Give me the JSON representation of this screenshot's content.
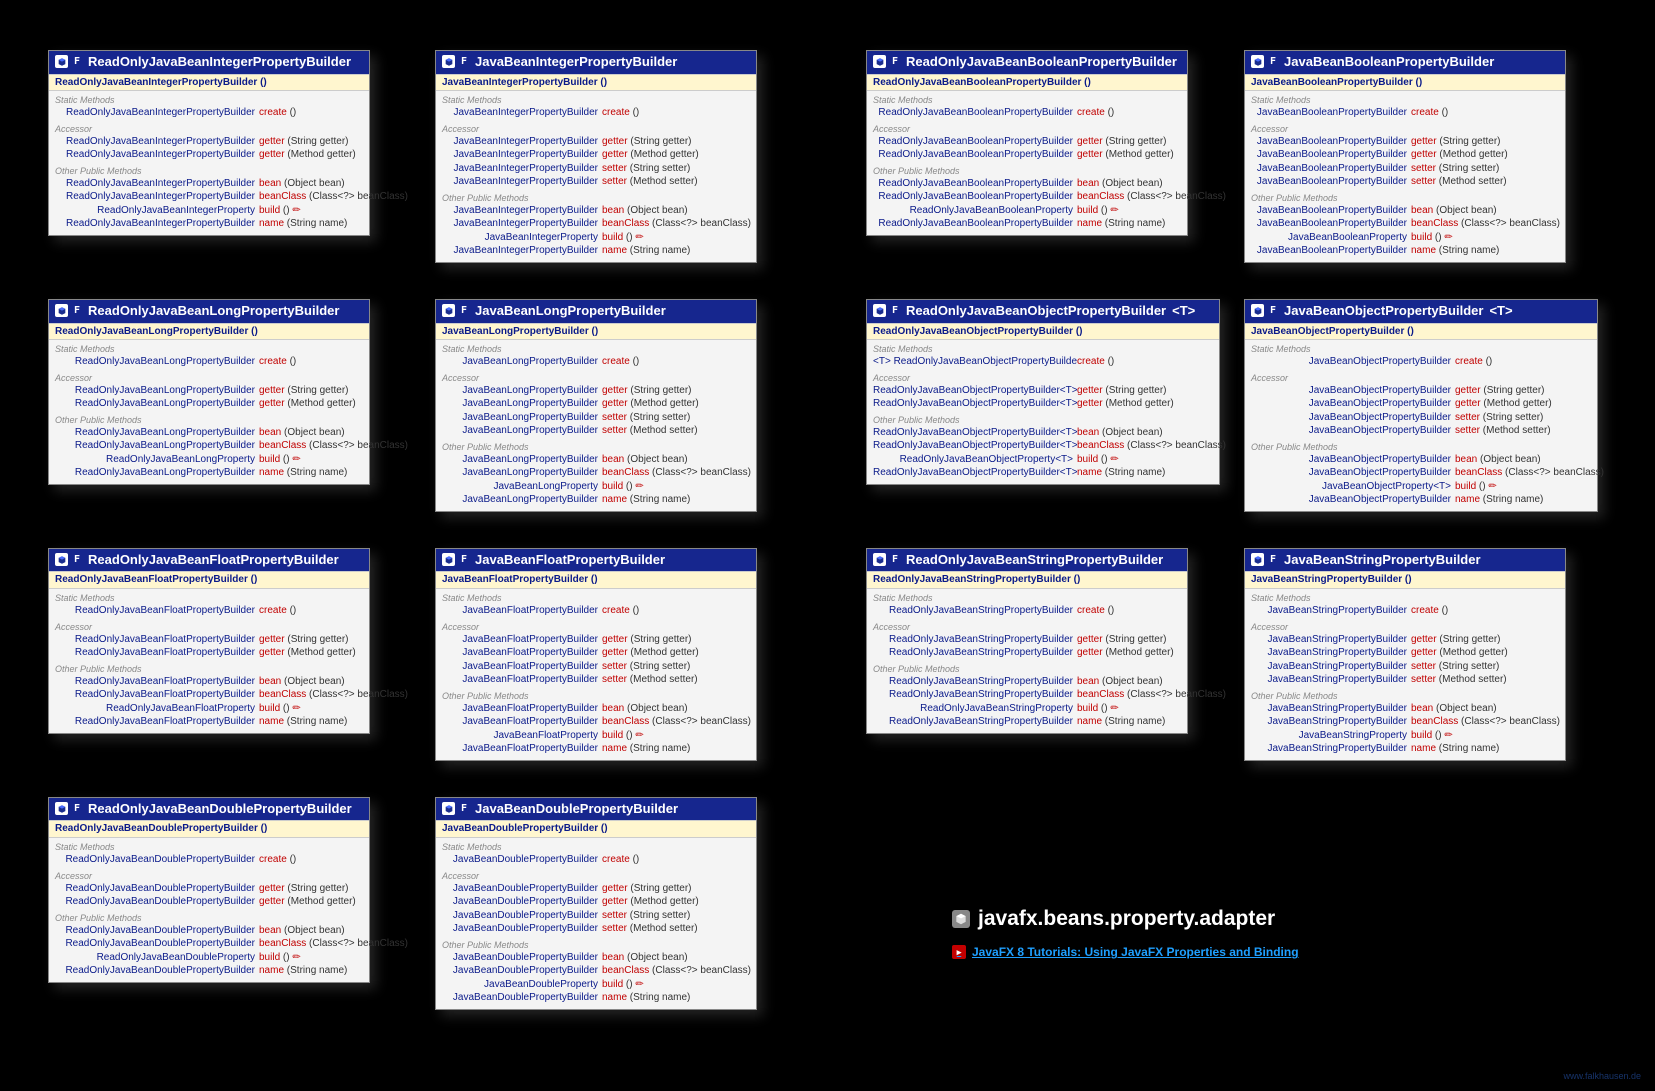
{
  "package_title": "javafx.beans.property.adapter",
  "tutorial_link": "JavaFX 8 Tutorials: Using JavaFX Properties and Binding",
  "watermark": "www.falkhausen.de",
  "final_prefix": "F",
  "sections": {
    "static": "Static Methods",
    "accessor": "Accessor",
    "other": "Other Public Methods"
  },
  "classes": [
    {
      "id": "ro-integer",
      "is_final": true,
      "title": "ReadOnlyJavaBeanIntegerPropertyBuilder",
      "constructor": "ReadOnlyJavaBeanIntegerPropertyBuilder ()",
      "static": [
        {
          "ret": "ReadOnlyJavaBeanIntegerPropertyBuilder",
          "name": "create",
          "params": "()"
        }
      ],
      "accessor": [
        {
          "ret": "ReadOnlyJavaBeanIntegerPropertyBuilder",
          "name": "getter",
          "params": "(String getter)"
        },
        {
          "ret": "ReadOnlyJavaBeanIntegerPropertyBuilder",
          "name": "getter",
          "params": "(Method getter)"
        }
      ],
      "other": [
        {
          "ret": "ReadOnlyJavaBeanIntegerPropertyBuilder",
          "name": "bean",
          "params": "(Object bean)"
        },
        {
          "ret": "ReadOnlyJavaBeanIntegerPropertyBuilder",
          "name": "beanClass",
          "params": "(Class<?> beanClass)"
        },
        {
          "ret": "ReadOnlyJavaBeanIntegerProperty",
          "name": "build",
          "params": "()",
          "throws": true
        },
        {
          "ret": "ReadOnlyJavaBeanIntegerPropertyBuilder",
          "name": "name",
          "params": "(String name)"
        }
      ]
    },
    {
      "id": "rw-integer",
      "is_final": true,
      "title": "JavaBeanIntegerPropertyBuilder",
      "constructor": "JavaBeanIntegerPropertyBuilder ()",
      "static": [
        {
          "ret": "JavaBeanIntegerPropertyBuilder",
          "name": "create",
          "params": "()"
        }
      ],
      "accessor": [
        {
          "ret": "JavaBeanIntegerPropertyBuilder",
          "name": "getter",
          "params": "(String getter)"
        },
        {
          "ret": "JavaBeanIntegerPropertyBuilder",
          "name": "getter",
          "params": "(Method getter)"
        },
        {
          "ret": "JavaBeanIntegerPropertyBuilder",
          "name": "setter",
          "params": "(String setter)"
        },
        {
          "ret": "JavaBeanIntegerPropertyBuilder",
          "name": "setter",
          "params": "(Method setter)"
        }
      ],
      "other": [
        {
          "ret": "JavaBeanIntegerPropertyBuilder",
          "name": "bean",
          "params": "(Object bean)"
        },
        {
          "ret": "JavaBeanIntegerPropertyBuilder",
          "name": "beanClass",
          "params": "(Class<?> beanClass)"
        },
        {
          "ret": "JavaBeanIntegerProperty",
          "name": "build",
          "params": "()",
          "throws": true
        },
        {
          "ret": "JavaBeanIntegerPropertyBuilder",
          "name": "name",
          "params": "(String name)"
        }
      ]
    },
    {
      "id": "ro-boolean",
      "is_final": true,
      "title": "ReadOnlyJavaBeanBooleanPropertyBuilder",
      "constructor": "ReadOnlyJavaBeanBooleanPropertyBuilder ()",
      "static": [
        {
          "ret": "ReadOnlyJavaBeanBooleanPropertyBuilder",
          "name": "create",
          "params": "()"
        }
      ],
      "accessor": [
        {
          "ret": "ReadOnlyJavaBeanBooleanPropertyBuilder",
          "name": "getter",
          "params": "(String getter)"
        },
        {
          "ret": "ReadOnlyJavaBeanBooleanPropertyBuilder",
          "name": "getter",
          "params": "(Method getter)"
        }
      ],
      "other": [
        {
          "ret": "ReadOnlyJavaBeanBooleanPropertyBuilder",
          "name": "bean",
          "params": "(Object bean)"
        },
        {
          "ret": "ReadOnlyJavaBeanBooleanPropertyBuilder",
          "name": "beanClass",
          "params": "(Class<?> beanClass)"
        },
        {
          "ret": "ReadOnlyJavaBeanBooleanProperty",
          "name": "build",
          "params": "()",
          "throws": true
        },
        {
          "ret": "ReadOnlyJavaBeanBooleanPropertyBuilder",
          "name": "name",
          "params": "(String name)"
        }
      ]
    },
    {
      "id": "rw-boolean",
      "is_final": true,
      "title": "JavaBeanBooleanPropertyBuilder",
      "constructor": "JavaBeanBooleanPropertyBuilder ()",
      "static": [
        {
          "ret": "JavaBeanBooleanPropertyBuilder",
          "name": "create",
          "params": "()"
        }
      ],
      "accessor": [
        {
          "ret": "JavaBeanBooleanPropertyBuilder",
          "name": "getter",
          "params": "(String getter)"
        },
        {
          "ret": "JavaBeanBooleanPropertyBuilder",
          "name": "getter",
          "params": "(Method getter)"
        },
        {
          "ret": "JavaBeanBooleanPropertyBuilder",
          "name": "setter",
          "params": "(String setter)"
        },
        {
          "ret": "JavaBeanBooleanPropertyBuilder",
          "name": "setter",
          "params": "(Method setter)"
        }
      ],
      "other": [
        {
          "ret": "JavaBeanBooleanPropertyBuilder",
          "name": "bean",
          "params": "(Object bean)"
        },
        {
          "ret": "JavaBeanBooleanPropertyBuilder",
          "name": "beanClass",
          "params": "(Class<?> beanClass)"
        },
        {
          "ret": "JavaBeanBooleanProperty",
          "name": "build",
          "params": "()",
          "throws": true
        },
        {
          "ret": "JavaBeanBooleanPropertyBuilder",
          "name": "name",
          "params": "(String name)"
        }
      ]
    },
    {
      "id": "ro-long",
      "is_final": true,
      "title": "ReadOnlyJavaBeanLongPropertyBuilder",
      "constructor": "ReadOnlyJavaBeanLongPropertyBuilder ()",
      "static": [
        {
          "ret": "ReadOnlyJavaBeanLongPropertyBuilder",
          "name": "create",
          "params": "()"
        }
      ],
      "accessor": [
        {
          "ret": "ReadOnlyJavaBeanLongPropertyBuilder",
          "name": "getter",
          "params": "(String getter)"
        },
        {
          "ret": "ReadOnlyJavaBeanLongPropertyBuilder",
          "name": "getter",
          "params": "(Method getter)"
        }
      ],
      "other": [
        {
          "ret": "ReadOnlyJavaBeanLongPropertyBuilder",
          "name": "bean",
          "params": "(Object bean)"
        },
        {
          "ret": "ReadOnlyJavaBeanLongPropertyBuilder",
          "name": "beanClass",
          "params": "(Class<?> beanClass)"
        },
        {
          "ret": "ReadOnlyJavaBeanLongProperty",
          "name": "build",
          "params": "()",
          "throws": true
        },
        {
          "ret": "ReadOnlyJavaBeanLongPropertyBuilder",
          "name": "name",
          "params": "(String name)"
        }
      ]
    },
    {
      "id": "rw-long",
      "is_final": true,
      "title": "JavaBeanLongPropertyBuilder",
      "constructor": "JavaBeanLongPropertyBuilder ()",
      "static": [
        {
          "ret": "JavaBeanLongPropertyBuilder",
          "name": "create",
          "params": "()"
        }
      ],
      "accessor": [
        {
          "ret": "JavaBeanLongPropertyBuilder",
          "name": "getter",
          "params": "(String getter)"
        },
        {
          "ret": "JavaBeanLongPropertyBuilder",
          "name": "getter",
          "params": "(Method getter)"
        },
        {
          "ret": "JavaBeanLongPropertyBuilder",
          "name": "setter",
          "params": "(String setter)"
        },
        {
          "ret": "JavaBeanLongPropertyBuilder",
          "name": "setter",
          "params": "(Method setter)"
        }
      ],
      "other": [
        {
          "ret": "JavaBeanLongPropertyBuilder",
          "name": "bean",
          "params": "(Object bean)"
        },
        {
          "ret": "JavaBeanLongPropertyBuilder",
          "name": "beanClass",
          "params": "(Class<?> beanClass)"
        },
        {
          "ret": "JavaBeanLongProperty",
          "name": "build",
          "params": "()",
          "throws": true
        },
        {
          "ret": "JavaBeanLongPropertyBuilder",
          "name": "name",
          "params": "(String name)"
        }
      ]
    },
    {
      "id": "ro-object",
      "is_final": true,
      "title": "ReadOnlyJavaBeanObjectPropertyBuilder",
      "generic": "<T>",
      "constructor": "ReadOnlyJavaBeanObjectPropertyBuilder ()",
      "static": [
        {
          "ret": "<T> ReadOnlyJavaBeanObjectPropertyBuilder<T>",
          "name": "create",
          "params": "()"
        }
      ],
      "accessor": [
        {
          "ret": "ReadOnlyJavaBeanObjectPropertyBuilder<T>",
          "name": "getter",
          "params": "(String getter)"
        },
        {
          "ret": "ReadOnlyJavaBeanObjectPropertyBuilder<T>",
          "name": "getter",
          "params": "(Method getter)"
        }
      ],
      "other": [
        {
          "ret": "ReadOnlyJavaBeanObjectPropertyBuilder<T>",
          "name": "bean",
          "params": "(Object bean)"
        },
        {
          "ret": "ReadOnlyJavaBeanObjectPropertyBuilder<T>",
          "name": "beanClass",
          "params": "(Class<?> beanClass)"
        },
        {
          "ret": "ReadOnlyJavaBeanObjectProperty<T>",
          "name": "build",
          "params": "()",
          "throws": true
        },
        {
          "ret": "ReadOnlyJavaBeanObjectPropertyBuilder<T>",
          "name": "name",
          "params": "(String name)"
        }
      ]
    },
    {
      "id": "rw-object",
      "is_final": true,
      "title": "JavaBeanObjectPropertyBuilder",
      "generic": "<T>",
      "constructor": "JavaBeanObjectPropertyBuilder ()",
      "static": [
        {
          "ret": "JavaBeanObjectPropertyBuilder",
          "name": "create",
          "params": "()"
        }
      ],
      "accessor": [
        {
          "ret": "JavaBeanObjectPropertyBuilder",
          "name": "getter",
          "params": "(String getter)"
        },
        {
          "ret": "JavaBeanObjectPropertyBuilder",
          "name": "getter",
          "params": "(Method getter)"
        },
        {
          "ret": "JavaBeanObjectPropertyBuilder",
          "name": "setter",
          "params": "(String setter)"
        },
        {
          "ret": "JavaBeanObjectPropertyBuilder",
          "name": "setter",
          "params": "(Method setter)"
        }
      ],
      "other": [
        {
          "ret": "JavaBeanObjectPropertyBuilder",
          "name": "bean",
          "params": "(Object bean)"
        },
        {
          "ret": "JavaBeanObjectPropertyBuilder",
          "name": "beanClass",
          "params": "(Class<?> beanClass)"
        },
        {
          "ret": "JavaBeanObjectProperty<T>",
          "name": "build",
          "params": "()",
          "throws": true
        },
        {
          "ret": "JavaBeanObjectPropertyBuilder",
          "name": "name",
          "params": "(String name)"
        }
      ]
    },
    {
      "id": "ro-float",
      "is_final": true,
      "title": "ReadOnlyJavaBeanFloatPropertyBuilder",
      "constructor": "ReadOnlyJavaBeanFloatPropertyBuilder ()",
      "static": [
        {
          "ret": "ReadOnlyJavaBeanFloatPropertyBuilder",
          "name": "create",
          "params": "()"
        }
      ],
      "accessor": [
        {
          "ret": "ReadOnlyJavaBeanFloatPropertyBuilder",
          "name": "getter",
          "params": "(String getter)"
        },
        {
          "ret": "ReadOnlyJavaBeanFloatPropertyBuilder",
          "name": "getter",
          "params": "(Method getter)"
        }
      ],
      "other": [
        {
          "ret": "ReadOnlyJavaBeanFloatPropertyBuilder",
          "name": "bean",
          "params": "(Object bean)"
        },
        {
          "ret": "ReadOnlyJavaBeanFloatPropertyBuilder",
          "name": "beanClass",
          "params": "(Class<?> beanClass)"
        },
        {
          "ret": "ReadOnlyJavaBeanFloatProperty",
          "name": "build",
          "params": "()",
          "throws": true
        },
        {
          "ret": "ReadOnlyJavaBeanFloatPropertyBuilder",
          "name": "name",
          "params": "(String name)"
        }
      ]
    },
    {
      "id": "rw-float",
      "is_final": true,
      "title": "JavaBeanFloatPropertyBuilder",
      "constructor": "JavaBeanFloatPropertyBuilder ()",
      "static": [
        {
          "ret": "JavaBeanFloatPropertyBuilder",
          "name": "create",
          "params": "()"
        }
      ],
      "accessor": [
        {
          "ret": "JavaBeanFloatPropertyBuilder",
          "name": "getter",
          "params": "(String getter)"
        },
        {
          "ret": "JavaBeanFloatPropertyBuilder",
          "name": "getter",
          "params": "(Method getter)"
        },
        {
          "ret": "JavaBeanFloatPropertyBuilder",
          "name": "setter",
          "params": "(String setter)"
        },
        {
          "ret": "JavaBeanFloatPropertyBuilder",
          "name": "setter",
          "params": "(Method setter)"
        }
      ],
      "other": [
        {
          "ret": "JavaBeanFloatPropertyBuilder",
          "name": "bean",
          "params": "(Object bean)"
        },
        {
          "ret": "JavaBeanFloatPropertyBuilder",
          "name": "beanClass",
          "params": "(Class<?> beanClass)"
        },
        {
          "ret": "JavaBeanFloatProperty",
          "name": "build",
          "params": "()",
          "throws": true
        },
        {
          "ret": "JavaBeanFloatPropertyBuilder",
          "name": "name",
          "params": "(String name)"
        }
      ]
    },
    {
      "id": "ro-string",
      "is_final": true,
      "title": "ReadOnlyJavaBeanStringPropertyBuilder",
      "constructor": "ReadOnlyJavaBeanStringPropertyBuilder ()",
      "static": [
        {
          "ret": "ReadOnlyJavaBeanStringPropertyBuilder",
          "name": "create",
          "params": "()"
        }
      ],
      "accessor": [
        {
          "ret": "ReadOnlyJavaBeanStringPropertyBuilder",
          "name": "getter",
          "params": "(String getter)"
        },
        {
          "ret": "ReadOnlyJavaBeanStringPropertyBuilder",
          "name": "getter",
          "params": "(Method getter)"
        }
      ],
      "other": [
        {
          "ret": "ReadOnlyJavaBeanStringPropertyBuilder",
          "name": "bean",
          "params": "(Object bean)"
        },
        {
          "ret": "ReadOnlyJavaBeanStringPropertyBuilder",
          "name": "beanClass",
          "params": "(Class<?> beanClass)"
        },
        {
          "ret": "ReadOnlyJavaBeanStringProperty",
          "name": "build",
          "params": "()",
          "throws": true
        },
        {
          "ret": "ReadOnlyJavaBeanStringPropertyBuilder",
          "name": "name",
          "params": "(String name)"
        }
      ]
    },
    {
      "id": "rw-string",
      "is_final": true,
      "title": "JavaBeanStringPropertyBuilder",
      "constructor": "JavaBeanStringPropertyBuilder ()",
      "static": [
        {
          "ret": "JavaBeanStringPropertyBuilder",
          "name": "create",
          "params": "()"
        }
      ],
      "accessor": [
        {
          "ret": "JavaBeanStringPropertyBuilder",
          "name": "getter",
          "params": "(String getter)"
        },
        {
          "ret": "JavaBeanStringPropertyBuilder",
          "name": "getter",
          "params": "(Method getter)"
        },
        {
          "ret": "JavaBeanStringPropertyBuilder",
          "name": "setter",
          "params": "(String setter)"
        },
        {
          "ret": "JavaBeanStringPropertyBuilder",
          "name": "setter",
          "params": "(Method setter)"
        }
      ],
      "other": [
        {
          "ret": "JavaBeanStringPropertyBuilder",
          "name": "bean",
          "params": "(Object bean)"
        },
        {
          "ret": "JavaBeanStringPropertyBuilder",
          "name": "beanClass",
          "params": "(Class<?> beanClass)"
        },
        {
          "ret": "JavaBeanStringProperty",
          "name": "build",
          "params": "()",
          "throws": true
        },
        {
          "ret": "JavaBeanStringPropertyBuilder",
          "name": "name",
          "params": "(String name)"
        }
      ]
    },
    {
      "id": "ro-double",
      "is_final": true,
      "title": "ReadOnlyJavaBeanDoublePropertyBuilder",
      "constructor": "ReadOnlyJavaBeanDoublePropertyBuilder ()",
      "static": [
        {
          "ret": "ReadOnlyJavaBeanDoublePropertyBuilder",
          "name": "create",
          "params": "()"
        }
      ],
      "accessor": [
        {
          "ret": "ReadOnlyJavaBeanDoublePropertyBuilder",
          "name": "getter",
          "params": "(String getter)"
        },
        {
          "ret": "ReadOnlyJavaBeanDoublePropertyBuilder",
          "name": "getter",
          "params": "(Method getter)"
        }
      ],
      "other": [
        {
          "ret": "ReadOnlyJavaBeanDoublePropertyBuilder",
          "name": "bean",
          "params": "(Object bean)"
        },
        {
          "ret": "ReadOnlyJavaBeanDoublePropertyBuilder",
          "name": "beanClass",
          "params": "(Class<?> beanClass)"
        },
        {
          "ret": "ReadOnlyJavaBeanDoubleProperty",
          "name": "build",
          "params": "()",
          "throws": true
        },
        {
          "ret": "ReadOnlyJavaBeanDoublePropertyBuilder",
          "name": "name",
          "params": "(String name)"
        }
      ]
    },
    {
      "id": "rw-double",
      "is_final": true,
      "title": "JavaBeanDoublePropertyBuilder",
      "constructor": "JavaBeanDoublePropertyBuilder ()",
      "static": [
        {
          "ret": "JavaBeanDoublePropertyBuilder",
          "name": "create",
          "params": "()"
        }
      ],
      "accessor": [
        {
          "ret": "JavaBeanDoublePropertyBuilder",
          "name": "getter",
          "params": "(String getter)"
        },
        {
          "ret": "JavaBeanDoublePropertyBuilder",
          "name": "getter",
          "params": "(Method getter)"
        },
        {
          "ret": "JavaBeanDoublePropertyBuilder",
          "name": "setter",
          "params": "(String setter)"
        },
        {
          "ret": "JavaBeanDoublePropertyBuilder",
          "name": "setter",
          "params": "(Method setter)"
        }
      ],
      "other": [
        {
          "ret": "JavaBeanDoublePropertyBuilder",
          "name": "bean",
          "params": "(Object bean)"
        },
        {
          "ret": "JavaBeanDoublePropertyBuilder",
          "name": "beanClass",
          "params": "(Class<?> beanClass)"
        },
        {
          "ret": "JavaBeanDoubleProperty",
          "name": "build",
          "params": "()",
          "throws": true
        },
        {
          "ret": "JavaBeanDoublePropertyBuilder",
          "name": "name",
          "params": "(String name)"
        }
      ]
    }
  ]
}
